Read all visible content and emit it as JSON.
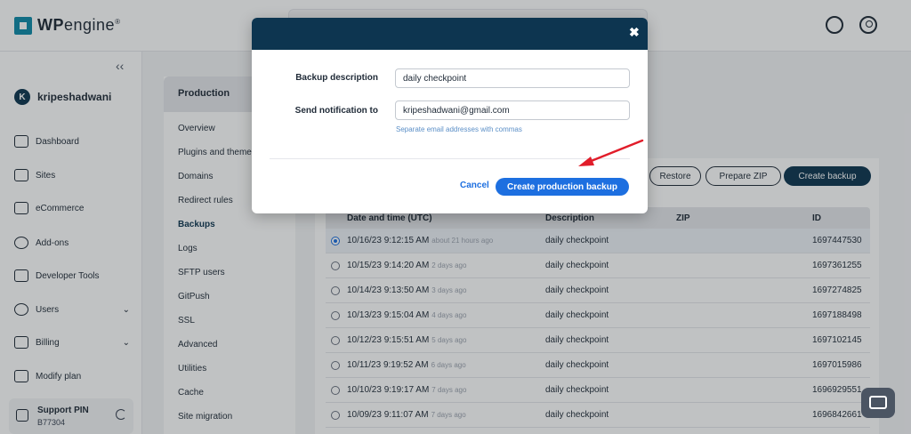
{
  "brand": {
    "name_bold": "WP",
    "name_thin": "engine",
    "reg": "®"
  },
  "header": {
    "help_icon": "headset-icon",
    "user_icon": "user-circle-icon"
  },
  "account": {
    "initial": "K",
    "name": "kripeshadwani"
  },
  "nav": {
    "collapse_glyph": "‹‹",
    "items": [
      {
        "label": "Dashboard",
        "icon": "activity-icon"
      },
      {
        "label": "Sites",
        "icon": "browser-icon"
      },
      {
        "label": "eCommerce",
        "icon": "store-icon"
      },
      {
        "label": "Add-ons",
        "icon": "plus-circle-icon"
      },
      {
        "label": "Developer Tools",
        "icon": "wrench-icon"
      },
      {
        "label": "Users",
        "icon": "users-icon",
        "chevron": "⌄"
      },
      {
        "label": "Billing",
        "icon": "receipt-icon",
        "chevron": "⌄"
      },
      {
        "label": "Modify plan",
        "icon": "sliders-icon"
      }
    ]
  },
  "support": {
    "label": "Support PIN",
    "pin": "B77304"
  },
  "environment": {
    "title": "Production",
    "items": [
      "Overview",
      "Plugins and themes",
      "Domains",
      "Redirect rules",
      "Backups",
      "Logs",
      "SFTP users",
      "GitPush",
      "SSL",
      "Advanced",
      "Utilities",
      "Cache",
      "Site migration"
    ],
    "active": "Backups"
  },
  "backups": {
    "buttons": {
      "restore": "Restore",
      "prepare_zip": "Prepare ZIP",
      "create": "Create backup"
    },
    "columns": {
      "date": "Date and time (UTC)",
      "description": "Description",
      "zip": "ZIP",
      "id": "ID"
    },
    "rows": [
      {
        "date": "10/16/23 9:12:15 AM",
        "relative": "about 21 hours ago",
        "description": "daily checkpoint",
        "id": "1697447530",
        "selected": true
      },
      {
        "date": "10/15/23 9:14:20 AM",
        "relative": "2 days ago",
        "description": "daily checkpoint",
        "id": "1697361255"
      },
      {
        "date": "10/14/23 9:13:50 AM",
        "relative": "3 days ago",
        "description": "daily checkpoint",
        "id": "1697274825"
      },
      {
        "date": "10/13/23 9:15:04 AM",
        "relative": "4 days ago",
        "description": "daily checkpoint",
        "id": "1697188498"
      },
      {
        "date": "10/12/23 9:15:51 AM",
        "relative": "5 days ago",
        "description": "daily checkpoint",
        "id": "1697102145"
      },
      {
        "date": "10/11/23 9:19:52 AM",
        "relative": "6 days ago",
        "description": "daily checkpoint",
        "id": "1697015986"
      },
      {
        "date": "10/10/23 9:19:17 AM",
        "relative": "7 days ago",
        "description": "daily checkpoint",
        "id": "1696929551"
      },
      {
        "date": "10/09/23 9:11:07 AM",
        "relative": "7 days ago",
        "description": "daily checkpoint",
        "id": "1696842661"
      }
    ]
  },
  "modal": {
    "close_glyph": "✖",
    "description_label": "Backup description",
    "description_value": "daily checkpoint",
    "notify_label": "Send notification to",
    "notify_value": "kripeshadwani@gmail.com",
    "notify_hint": "Separate email addresses with commas",
    "cancel_label": "Cancel",
    "submit_label": "Create production backup"
  },
  "annotation": {
    "color": "#e11d2a"
  },
  "chat": {
    "icon": "chat-icon"
  },
  "colors": {
    "navy": "#0d3550",
    "accent": "#1d6fe0",
    "brand": "#0e8aa8"
  }
}
